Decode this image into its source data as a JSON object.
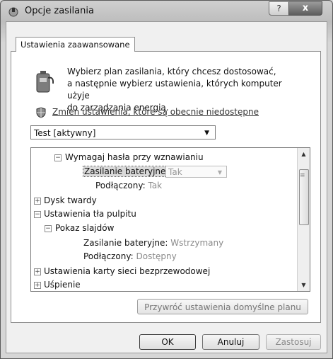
{
  "window": {
    "title": "Opcje zasilania",
    "help_label": "?",
    "close_label": "x"
  },
  "tab": {
    "label": "Ustawienia zaawansowane"
  },
  "intro": {
    "line1": "Wybierz plan zasilania, który chcesz dostosować,",
    "line2": "a następnie wybierz ustawienia, których komputer użyje",
    "line3": "do zarządzania energią."
  },
  "change_settings_link": "Zmień ustawienia, które są obecnie niedostępne",
  "plan_select": {
    "value": "Test [aktywny]"
  },
  "tree": {
    "r1_label": "Wymagaj hasła przy wznawianiu",
    "r2_label": "Zasilanie bateryjne:",
    "r2_value": "Tak",
    "r3_label": "Podłączony:",
    "r3_value": "Tak",
    "r4_label": "Dysk twardy",
    "r5_label": "Ustawienia tła pulpitu",
    "r6_label": "Pokaz slajdów",
    "r7_label": "Zasilanie bateryjne:",
    "r7_value": "Wstrzymany",
    "r8_label": "Podłączony:",
    "r8_value": "Dostępny",
    "r9_label": "Ustawienia karty sieci bezprzewodowej",
    "r10_label": "Uśpienie"
  },
  "restore_button": "Przywróć ustawienia domyślne planu",
  "buttons": {
    "ok": "OK",
    "cancel": "Anuluj",
    "apply": "Zastosuj"
  }
}
